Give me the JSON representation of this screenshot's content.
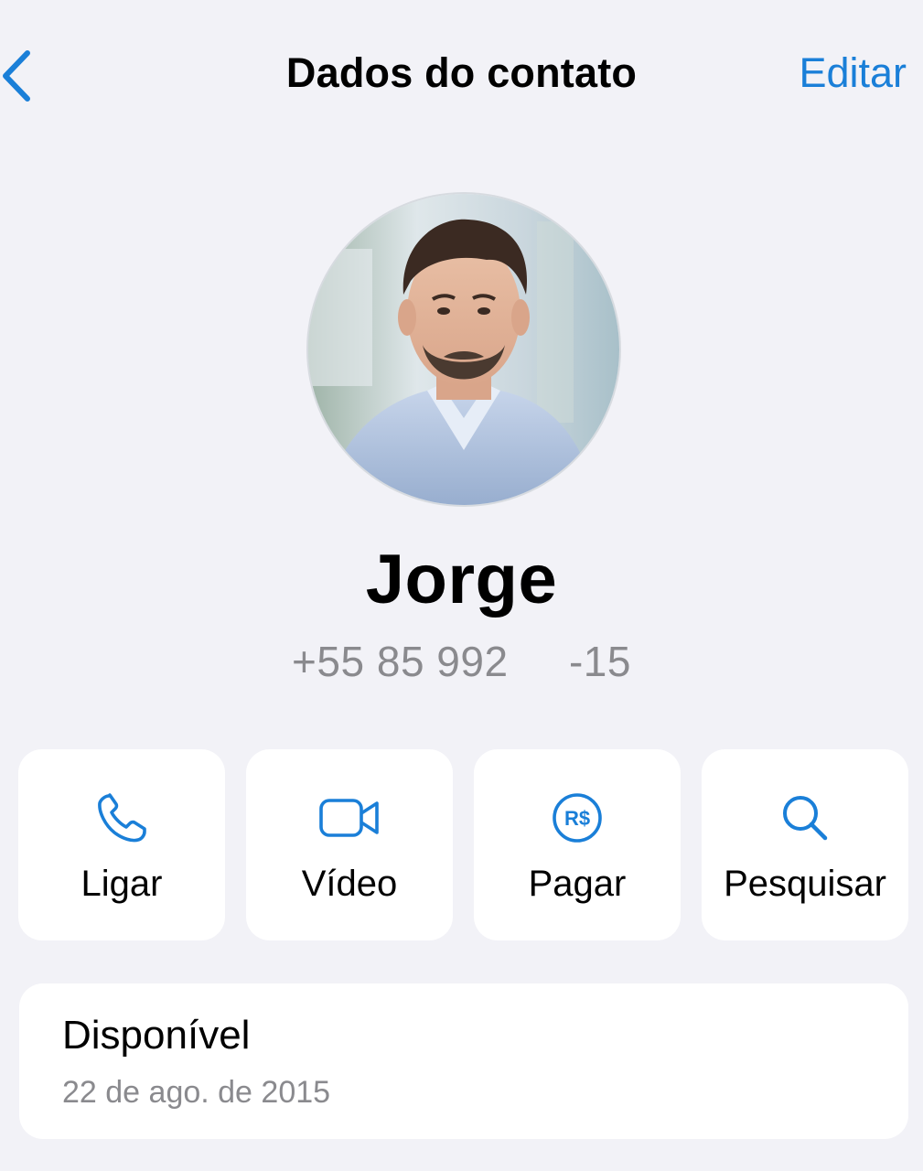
{
  "nav": {
    "title": "Dados do contato",
    "edit_label": "Editar",
    "back_icon": "chevron-left-icon"
  },
  "contact": {
    "name": "Jorge",
    "phone": "+55 85 992     -15"
  },
  "actions": [
    {
      "label": "Ligar",
      "icon": "phone-icon"
    },
    {
      "label": "Vídeo",
      "icon": "video-camera-icon"
    },
    {
      "label": "Pagar",
      "icon": "real-currency-icon",
      "icon_text": "R$"
    },
    {
      "label": "Pesquisar",
      "icon": "search-icon"
    }
  ],
  "status": {
    "text": "Disponível",
    "date": "22 de ago. de 2015"
  },
  "colors": {
    "accent": "#1a7fd8",
    "background": "#f2f2f7",
    "card": "#ffffff",
    "secondary_text": "#8a8a8e"
  }
}
